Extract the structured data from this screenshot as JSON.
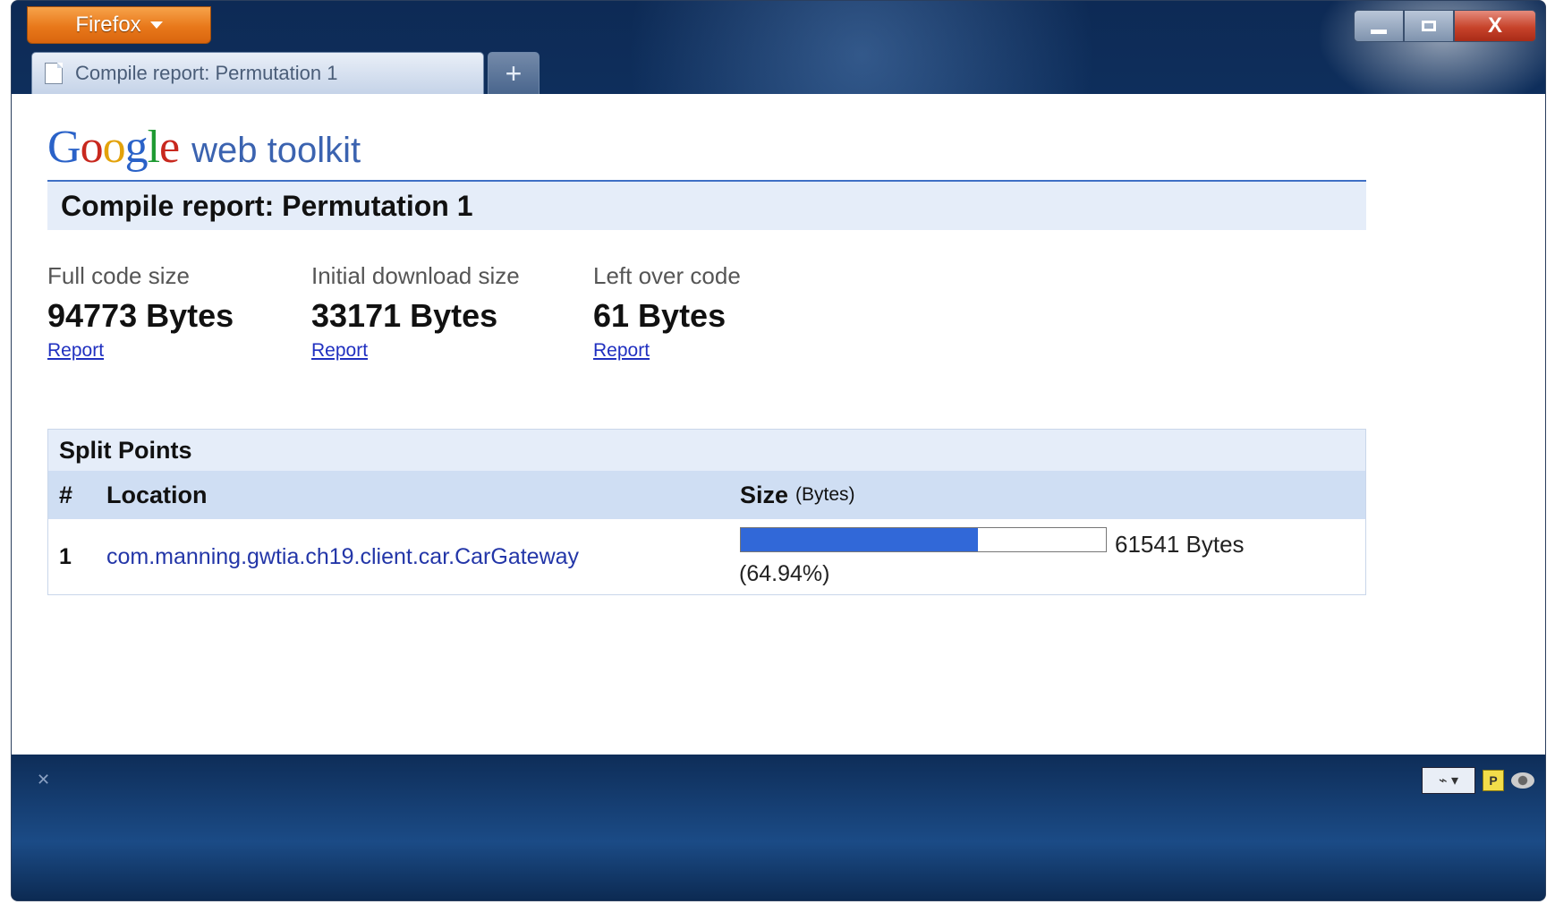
{
  "browser": {
    "menu_button": "Firefox",
    "tab_title": "Compile report: Permutation 1",
    "new_tab_label": "+",
    "window_controls": {
      "close": "X"
    }
  },
  "logo": {
    "google": [
      "G",
      "o",
      "o",
      "g",
      "l",
      "e"
    ],
    "google_colors": [
      "#2a62c8",
      "#c8281e",
      "#e3a20a",
      "#2a62c8",
      "#1e9a32",
      "#c8281e"
    ],
    "product": "web toolkit"
  },
  "page": {
    "title": "Compile report: Permutation 1"
  },
  "stats": [
    {
      "label": "Full code size",
      "value": "94773 Bytes",
      "link": "Report"
    },
    {
      "label": "Initial download size",
      "value": "33171 Bytes",
      "link": "Report"
    },
    {
      "label": "Left over code",
      "value": "61 Bytes",
      "link": "Report"
    }
  ],
  "split_points": {
    "title": "Split Points",
    "columns": {
      "num": "#",
      "location": "Location",
      "size": "Size",
      "size_unit": "(Bytes)"
    },
    "rows": [
      {
        "num": "1",
        "location": "com.manning.gwtia.ch19.client.car.CarGateway",
        "bytes": "61541 Bytes",
        "percent_label": "(64.94%)",
        "percent_value": 64.94
      }
    ]
  },
  "colors": {
    "accent": "#3f6fc5",
    "bar_fill": "#3168d8",
    "link": "#2336a8",
    "firefox_orange": "#e8781a"
  }
}
